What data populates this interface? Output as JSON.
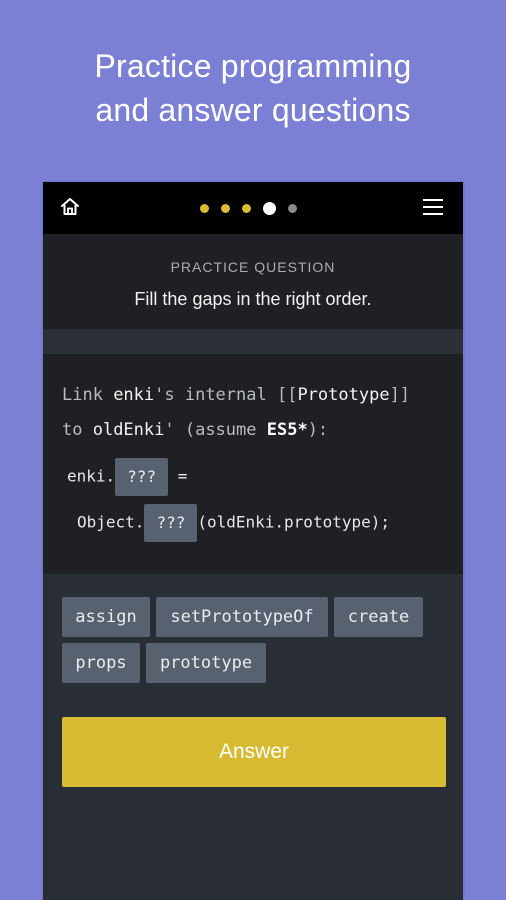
{
  "headline": {
    "line1": "Practice programming",
    "line2": "and answer questions"
  },
  "topbar": {
    "home_icon": "home-icon",
    "menu_icon": "hamburger-menu-icon",
    "progress": {
      "completed": 3,
      "current": 4,
      "total": 5
    }
  },
  "question": {
    "label": "PRACTICE QUESTION",
    "text": "Fill the gaps in the right order."
  },
  "code": {
    "line1": {
      "pre": "Link ",
      "kw1": "enki",
      "mid": "'s internal [[",
      "kw2": "Prototype",
      "post": "]]"
    },
    "line2": {
      "pre": "to ",
      "kw1": "oldEnki",
      "mid": "' (assume ",
      "kw2": "ES5*",
      "post": "):"
    },
    "line3": {
      "pre": "enki.",
      "gap": "???",
      "post": " ="
    },
    "line4": {
      "pre": "Object.",
      "gap": "???",
      "post": "(oldEnki.prototype);"
    }
  },
  "choices": [
    "assign",
    "setPrototypeOf",
    "create",
    "props",
    "prototype"
  ],
  "answer_label": "Answer",
  "colors": {
    "background": "#7b80d4",
    "accent": "#d6bb32",
    "chip": "#586170",
    "panel": "#1f2024"
  }
}
